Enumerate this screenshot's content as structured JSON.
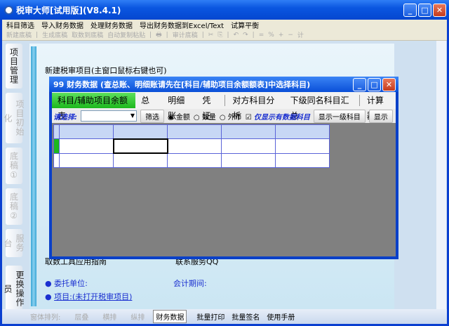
{
  "window": {
    "title": "税审大师[试用版](V8.4.1)"
  },
  "menu": [
    "科目筛选",
    "导入财务数据",
    "处理财务数据",
    "导出财务数据到Excel/Text",
    "试算平衡"
  ],
  "toolbar": [
    "新建底稿",
    "生成底稿",
    "取数到底稿",
    "自动复制粘贴",
    "审计底稿",
    "计"
  ],
  "side_tabs": [
    "项目管理",
    "项目初始化",
    "底稿①",
    "底稿②",
    "服务台",
    "更换操作员"
  ],
  "pane": {
    "new_project": "新建税审项目(主窗口鼠标右键也可)",
    "guide": "取数工具应用指南",
    "qq": "联系服务QQ",
    "client_label": "委托单位:",
    "period_label": "会计期间:",
    "project_link": "项目:(未打开税审项目)"
  },
  "dialog": {
    "title": "99  财务数据   (查总账、明细账请先在[科目/辅助项目余额额表]中选择科目)",
    "tabs": [
      "科目/辅助项目余额表",
      "总账",
      "明细账",
      "凭证",
      "对方科目分析",
      "下级同名科目汇总",
      "计算器"
    ],
    "filter": {
      "label": "请选择:",
      "select_value": "",
      "filter_btn": "筛选",
      "radio_amount": "金额",
      "radio_qty": "数量",
      "radio_fx": "外币",
      "checkbox": "仅显示有数据科目",
      "show_level1": "显示一级科目",
      "show_more": "显示"
    }
  },
  "bottom": {
    "arrange_label": "窗体排列:",
    "cascade": "层叠",
    "tile_h": "横排",
    "tile_v": "纵排",
    "fin_data": "财务数据",
    "batch_print": "批量打印",
    "batch_sign": "批量签名",
    "manual": "使用手册"
  }
}
